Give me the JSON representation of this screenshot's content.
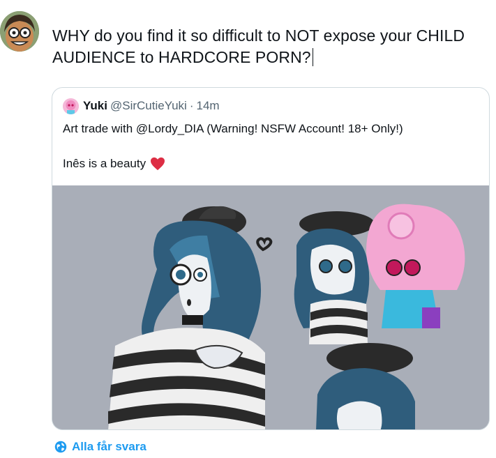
{
  "compose": {
    "text": "WHY do you find it so difficult to NOT expose your CHILD AUDIENCE to HARDCORE PORN?"
  },
  "quoted_tweet": {
    "author_name": "Yuki",
    "author_handle": "@SirCutieYuki",
    "separator": "·",
    "time": "14m",
    "text_line1": "Art trade with @Lordy_DIA (Warning! NSFW Account! 18+ Only!)",
    "text_line2": "Inês is a beauty",
    "emoji": "heart-icon"
  },
  "reply_setting": {
    "label": "Alla får svara",
    "icon": "globe-icon"
  },
  "colors": {
    "accent": "#1d9bf0",
    "heart": "#e0245e",
    "border": "#cfd9de",
    "muted": "#536471"
  }
}
